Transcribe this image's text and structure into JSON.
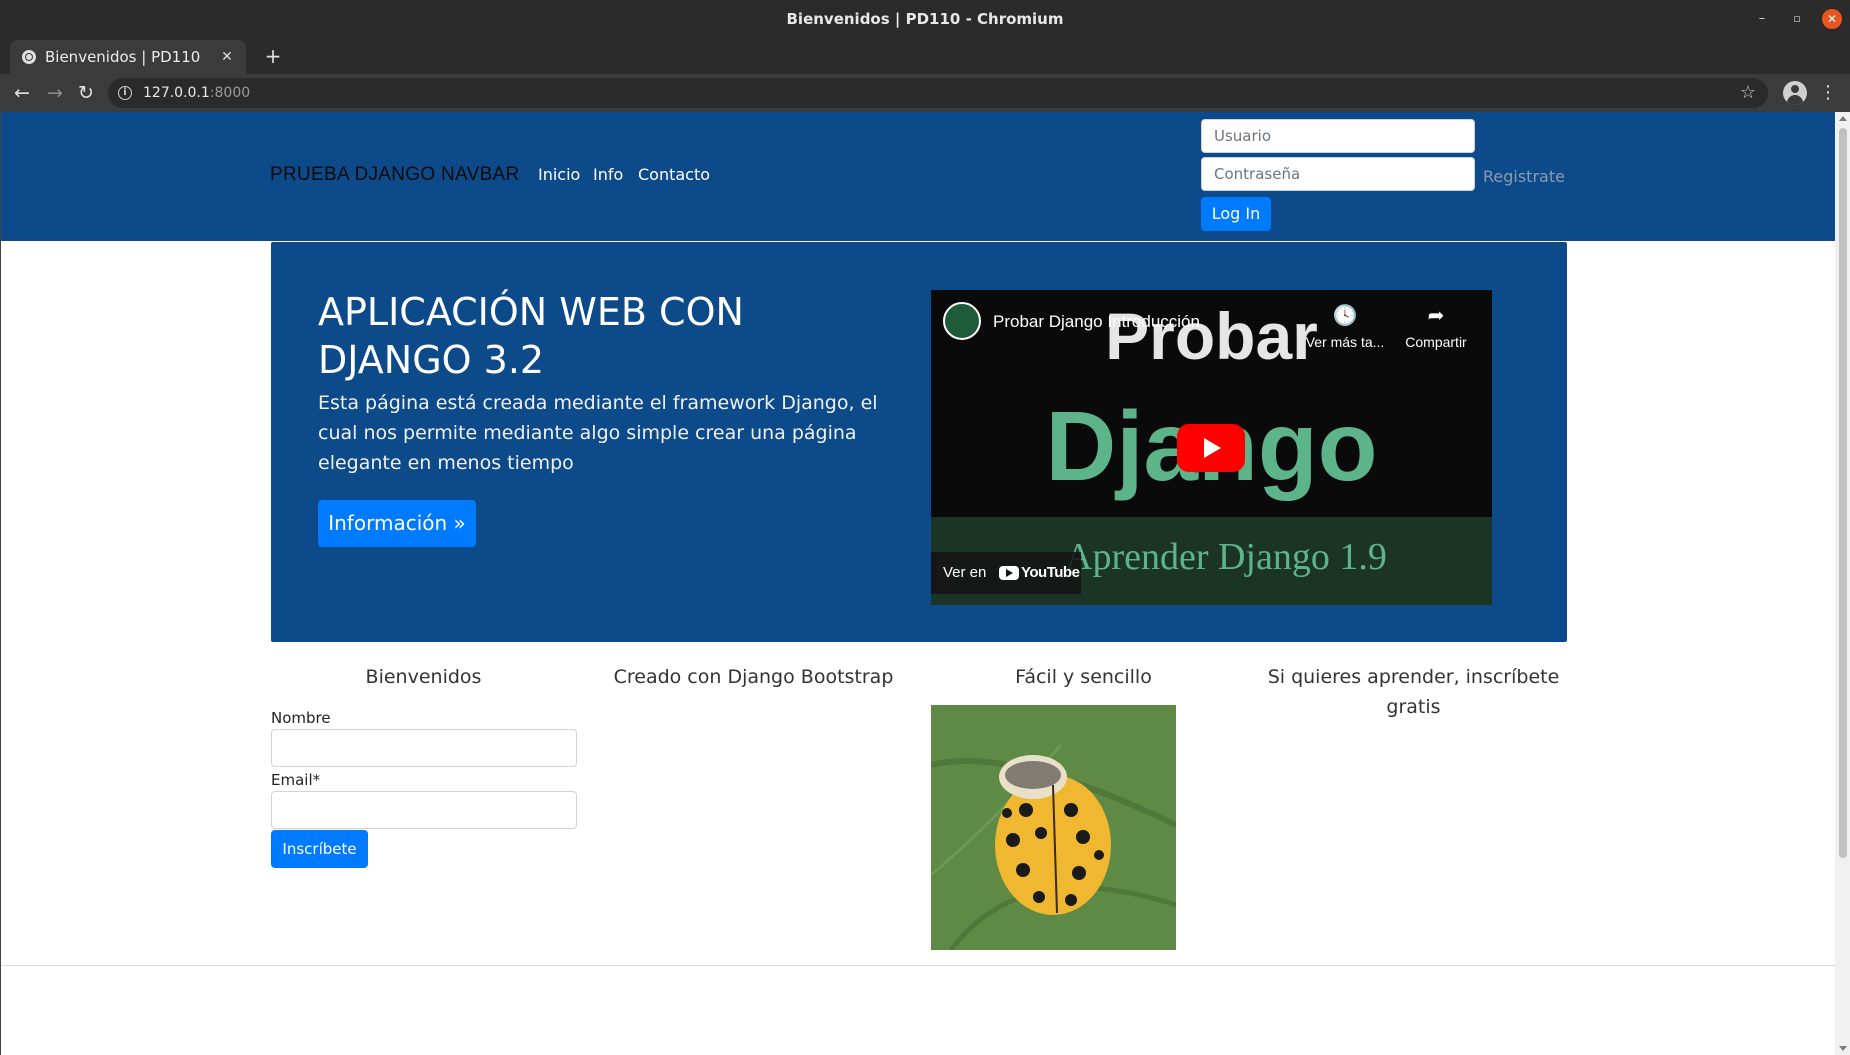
{
  "window": {
    "title": "Bienvenidos | PD110 - Chromium",
    "minimize": "–",
    "maximize": "▫",
    "close": "✕"
  },
  "tab": {
    "title": "Bienvenidos | PD110",
    "close": "✕",
    "new_tab": "+"
  },
  "toolbar": {
    "back": "←",
    "forward": "→",
    "reload": "↻",
    "info": "i",
    "url_host": "127.0.0.1",
    "url_port": ":8000",
    "star": "☆",
    "menu": "⋮"
  },
  "navbar": {
    "brand": "PRUEBA DJANGO NAVBAR",
    "links": [
      "Inicio",
      "Info",
      "Contacto"
    ],
    "username_placeholder": "Usuario",
    "password_placeholder": "Contraseña",
    "register": "Registrate",
    "login": "Log In"
  },
  "jumbotron": {
    "heading": "APLICACIÓN WEB CON DJANGO 3.2",
    "lead": "Esta página está creada mediante el framework Django, el cual nos permite mediante algo simple crear una página elegante en menos tiempo",
    "button": "Información »"
  },
  "video": {
    "title": "Probar Django Introducción",
    "word1": "Probar",
    "word2": "Django",
    "band_text": "Aprender Django 1.9",
    "watch_later": "Ver más ta...",
    "share": "Compartir",
    "watch_on": "Ver en",
    "youtube": "YouTube",
    "clock_icon": "🕓",
    "share_icon": "➦"
  },
  "columns": {
    "c1": "Bienvenidos",
    "c2": "Creado con Django Bootstrap",
    "c3": "Fácil y sencillo",
    "c4": "Si quieres aprender, inscríbete gratis"
  },
  "form": {
    "nombre_label": "Nombre",
    "email_label": "Email*",
    "submit": "Inscríbete"
  },
  "colors": {
    "navbar_bg": "#0d4a8a",
    "primary": "#007bff",
    "video_green": "#5db38a"
  }
}
